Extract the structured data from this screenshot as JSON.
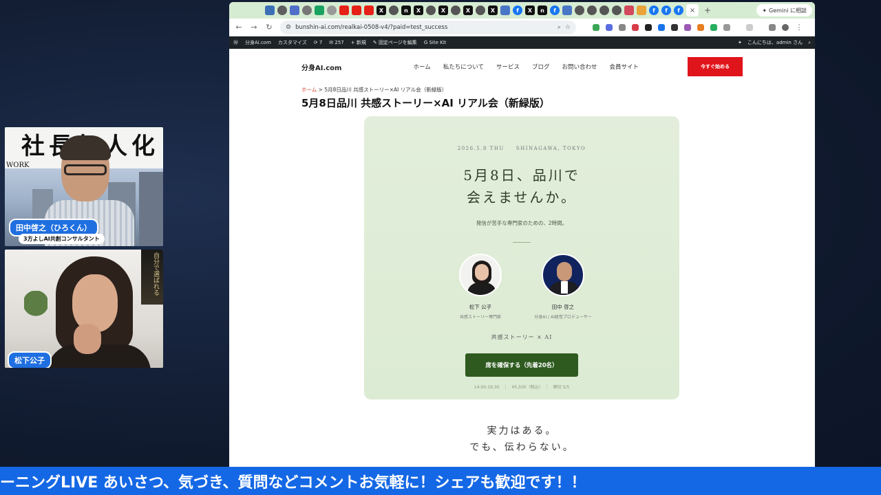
{
  "browser": {
    "url": "bunshin-ai.com/realkai-0508-v4/?paid=test_success",
    "gemini_label": "Gemini に相談",
    "tab_plus": "+",
    "close_tab": "×"
  },
  "wp_admin": {
    "site": "分身Ai.com",
    "customize": "カスタマイズ",
    "updates": "7",
    "comments": "257",
    "new": "新規",
    "edit": "固定ページを編集",
    "sitekit": "Site Kit",
    "greeting": "こんにちは、admin さん"
  },
  "site": {
    "logo": "分身AI.com",
    "menu": [
      "ホーム",
      "私たちについて",
      "サービス",
      "ブログ",
      "お問い合わせ",
      "会員サイト"
    ],
    "cta": "今すぐ始める"
  },
  "breadcrumb": {
    "home": "ホーム",
    "sep": " > ",
    "current": "5月8日品川 共感ストーリー×AI リアル会（新緑版）"
  },
  "page_title": "5月8日品川 共感ストーリー×AI リアル会（新緑版）",
  "hero": {
    "meta": "2026.5.8 THU　　SHINAGAWA, TOKYO",
    "headline_1": "5月8日、品川で",
    "headline_2": "会えませんか。",
    "sub": "発信が苦手な専門家のための、2時間。",
    "speakers": [
      {
        "name": "松下 公子",
        "role": "共感ストーリー専門家"
      },
      {
        "name": "田中 啓之",
        "role": "分身AI / AI経営プロデューサー"
      }
    ],
    "theme": "共感ストーリー × AI",
    "button": "席を確保する（先着20名）",
    "details": "14:00-16:30　｜　¥5,500（税込）　｜　締切 5/5"
  },
  "tagline_1": "実力はある。",
  "tagline_2": "でも、伝わらない。",
  "cams": {
    "cam1_name": "田中啓之（ひろくん）",
    "cam1_sub": "3方よしAI共創コンサルタント",
    "cam1_poster": "社長無人化",
    "cam1_work": "WORK",
    "cam2_name": "松下公子",
    "cam2_books": "自分で選ばれる"
  },
  "ticker": "ーニングLIVE あいさつ、気づき、質問などコメントお気軽に！シェアも歓迎です！！",
  "colors": {
    "ticker_bg": "#1568e5",
    "cta_red": "#e0141b",
    "hero_green": "#dcebd3",
    "button_green": "#2e5a1f"
  }
}
